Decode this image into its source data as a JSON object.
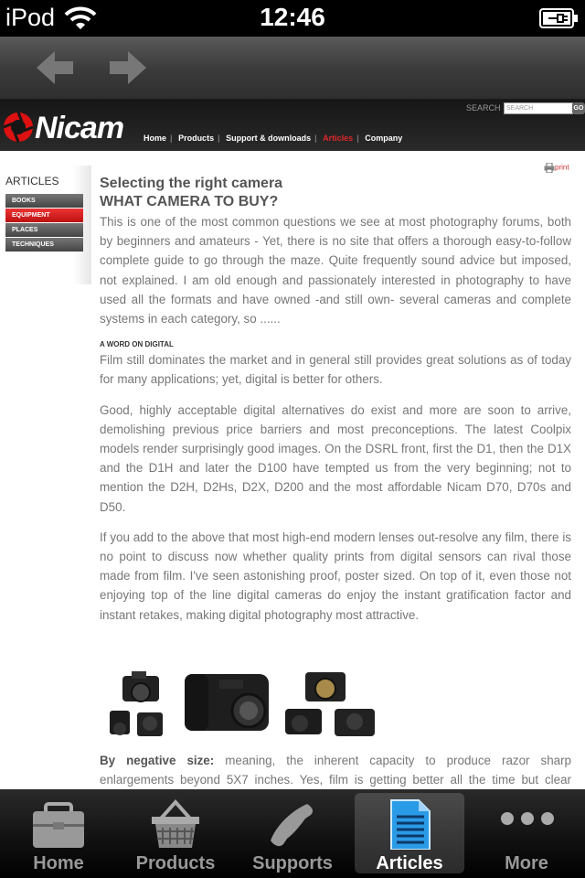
{
  "status_bar": {
    "carrier": "iPod",
    "time": "12:46"
  },
  "site": {
    "logo_text": "Nicam",
    "nav": [
      "Home",
      "Products",
      "Support & downloads",
      "Articles",
      "Company"
    ],
    "active_nav": "Articles",
    "search_label": "SEARCH",
    "search_placeholder": "SEARCH",
    "search_button": "GO"
  },
  "sidebar": {
    "title": "ARTICLES",
    "items": [
      {
        "label": "BOOKS"
      },
      {
        "label": "EQUIPMENT"
      },
      {
        "label": "PLACES"
      },
      {
        "label": "TECHNIQUES"
      }
    ],
    "active_item": "EQUIPMENT"
  },
  "print_label": "print",
  "article": {
    "title_line1": "Selecting the right camera",
    "title_line2": "WHAT CAMERA TO BUY?",
    "intro": "This is one of the most common questions we see at most photography forums, both by beginners and amateurs - Yet, there is no site that offers a thorough easy-to-follow complete guide to go through the maze. Quite frequently sound advice but imposed, not explained. I am old enough and passionately interested in photography to have used all the formats and have owned -and still own- several cameras and complete systems in each category, so ......",
    "section_heading": "A WORD ON DIGITAL",
    "paragraphs": [
      "Film still dominates the market and in general still provides great solutions as of today for many applications; yet, digital is better for others.",
      "Good, highly acceptable digital alternatives do exist and more are soon to arrive, demolishing previous price barriers and most preconceptions. The latest Coolpix models render surprisingly good images. On the DSRL front, first the D1, then the D1X and the D1H and later the D100 have tempted us from the very beginning; not to mention the D2H, D2Hs, D2X, D200 and the most affordable Nicam D70, D70s and D50.",
      "If you add to the above that most high-end modern lenses out-resolve any film, there is no point to discuss now whether quality prints from digital sensors can rival those made from film. I've seen astonishing proof, poster sized. On top of it, even those not enjoying top of the line digital cameras do enjoy the instant gratification factor and instant retakes, making digital photography most attractive."
    ],
    "last_bold": "By negative size:",
    "last_text": " meaning, the inherent capacity to produce razor sharp enlargements beyond 5X7 inches. Yes, film is getting better all the time but clear barriers still do exist, differences are noticeable to the naked eye."
  },
  "tab_bar": {
    "tabs": [
      {
        "label": "Home",
        "icon": "briefcase-icon"
      },
      {
        "label": "Products",
        "icon": "basket-icon"
      },
      {
        "label": "Supports",
        "icon": "phone-icon"
      },
      {
        "label": "Articles",
        "icon": "document-icon"
      },
      {
        "label": "More",
        "icon": "more-dots-icon"
      }
    ],
    "selected": "Articles"
  },
  "colors": {
    "accent_red": "#e0262a",
    "tab_selected_icon": "#2a9be6"
  }
}
